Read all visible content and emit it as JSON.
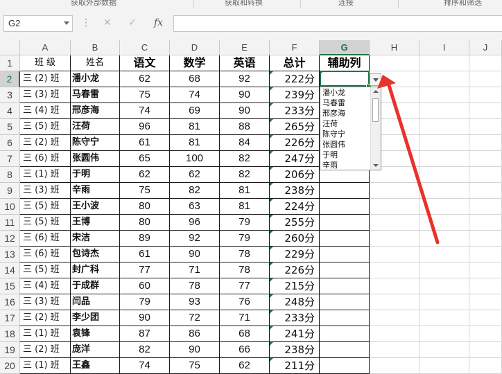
{
  "ribbon": {
    "groups": [
      "获取外部数据",
      "获取和转换",
      "连接",
      "排序和筛选"
    ]
  },
  "formula_bar": {
    "name_box": "G2",
    "cancel_icon": "✕",
    "enter_icon": "✓",
    "fx_label": "fx",
    "formula": ""
  },
  "columns": [
    "A",
    "B",
    "C",
    "D",
    "E",
    "F",
    "G",
    "H",
    "I",
    "J"
  ],
  "active_column": "G",
  "active_row": "2",
  "header_row": {
    "row": "1",
    "class": "班 级",
    "name": "姓名",
    "chinese": "语文",
    "math": "数学",
    "english": "英语",
    "total": "总计",
    "helper": "辅助列"
  },
  "rows": [
    {
      "row": "2",
      "class": "三 (2) 班",
      "name": "潘小龙",
      "chinese": "62",
      "math": "68",
      "english": "92",
      "total": "222分"
    },
    {
      "row": "3",
      "class": "三 (3) 班",
      "name": "马春雷",
      "chinese": "75",
      "math": "74",
      "english": "90",
      "total": "239分"
    },
    {
      "row": "4",
      "class": "三 (4) 班",
      "name": "邢彦海",
      "chinese": "74",
      "math": "69",
      "english": "90",
      "total": "233分"
    },
    {
      "row": "5",
      "class": "三 (5) 班",
      "name": "汪荷",
      "chinese": "96",
      "math": "81",
      "english": "88",
      "total": "265分"
    },
    {
      "row": "6",
      "class": "三 (2) 班",
      "name": "陈守宁",
      "chinese": "61",
      "math": "81",
      "english": "84",
      "total": "226分"
    },
    {
      "row": "7",
      "class": "三 (6) 班",
      "name": "张圆伟",
      "chinese": "65",
      "math": "100",
      "english": "82",
      "total": "247分"
    },
    {
      "row": "8",
      "class": "三 (1) 班",
      "name": "于明",
      "chinese": "62",
      "math": "62",
      "english": "82",
      "total": "206分"
    },
    {
      "row": "9",
      "class": "三 (3) 班",
      "name": "辛雨",
      "chinese": "75",
      "math": "82",
      "english": "81",
      "total": "238分"
    },
    {
      "row": "10",
      "class": "三 (5) 班",
      "name": "王小波",
      "chinese": "80",
      "math": "63",
      "english": "81",
      "total": "224分"
    },
    {
      "row": "11",
      "class": "三 (5) 班",
      "name": "王博",
      "chinese": "80",
      "math": "96",
      "english": "79",
      "total": "255分"
    },
    {
      "row": "12",
      "class": "三 (6) 班",
      "name": "宋洁",
      "chinese": "89",
      "math": "92",
      "english": "79",
      "total": "260分"
    },
    {
      "row": "13",
      "class": "三 (6) 班",
      "name": "包诗杰",
      "chinese": "61",
      "math": "90",
      "english": "78",
      "total": "229分"
    },
    {
      "row": "14",
      "class": "三 (5) 班",
      "name": "封广科",
      "chinese": "77",
      "math": "71",
      "english": "78",
      "total": "226分"
    },
    {
      "row": "15",
      "class": "三 (4) 班",
      "name": "于成群",
      "chinese": "60",
      "math": "78",
      "english": "77",
      "total": "215分"
    },
    {
      "row": "16",
      "class": "三 (3) 班",
      "name": "闫品",
      "chinese": "79",
      "math": "93",
      "english": "76",
      "total": "248分"
    },
    {
      "row": "17",
      "class": "三 (2) 班",
      "name": "李少团",
      "chinese": "90",
      "math": "72",
      "english": "71",
      "total": "233分"
    },
    {
      "row": "18",
      "class": "三 (1) 班",
      "name": "袁锋",
      "chinese": "87",
      "math": "86",
      "english": "68",
      "total": "241分"
    },
    {
      "row": "19",
      "class": "三 (2) 班",
      "name": "庞洋",
      "chinese": "82",
      "math": "90",
      "english": "66",
      "total": "238分"
    },
    {
      "row": "20",
      "class": "三 (1) 班",
      "name": "王鑫",
      "chinese": "74",
      "math": "75",
      "english": "62",
      "total": "211分"
    }
  ],
  "dropdown": {
    "items": [
      "潘小龙",
      "马春雷",
      "邢彦海",
      "汪荷",
      "陈守宁",
      "张圆伟",
      "于明",
      "辛雨"
    ]
  },
  "colors": {
    "accent": "#217346",
    "arrow": "#e8322a",
    "note_triangle": "#1e7b3c"
  },
  "icons": {
    "dropdown": "chevron-down-icon",
    "scroll_up": "scroll-up-icon",
    "scroll_down": "scroll-down-icon",
    "cancel": "close-icon",
    "enter": "check-icon",
    "function": "function-icon"
  }
}
